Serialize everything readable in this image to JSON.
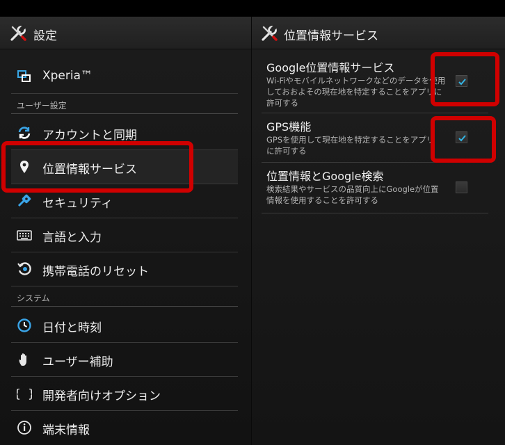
{
  "left_pane": {
    "title": "設定",
    "items": [
      {
        "label": "Xperia™",
        "icon": "xperia-icon"
      },
      {
        "label": "アカウントと同期",
        "icon": "sync-icon"
      },
      {
        "label": "位置情報サービス",
        "icon": "location-pin-icon"
      },
      {
        "label": "セキュリティ",
        "icon": "security-icon"
      },
      {
        "label": "言語と入力",
        "icon": "keyboard-icon"
      },
      {
        "label": "携帯電話のリセット",
        "icon": "reset-icon"
      },
      {
        "label": "日付と時刻",
        "icon": "clock-icon"
      },
      {
        "label": "ユーザー補助",
        "icon": "hand-icon"
      },
      {
        "label": "開発者向けオプション",
        "icon": "braces-icon"
      },
      {
        "label": "端末情報",
        "icon": "info-icon"
      }
    ],
    "sections": {
      "user_settings": "ユーザー設定",
      "system": "システム"
    }
  },
  "right_pane": {
    "title": "位置情報サービス",
    "prefs": [
      {
        "title": "Google位置情報サービス",
        "summary": "Wi-Fiやモバイルネットワークなどのデータを使用しておおよその現在地を特定することをアプリに許可する",
        "checked": true
      },
      {
        "title": "GPS機能",
        "summary": "GPSを使用して現在地を特定することをアプリに許可する",
        "checked": true
      },
      {
        "title": "位置情報とGoogle検索",
        "summary": "検索結果やサービスの品質向上にGoogleが位置情報を使用することを許可する",
        "checked": false
      }
    ]
  },
  "colors": {
    "annotation_red": "#d00000",
    "accent_blue": "#33b5e5"
  }
}
